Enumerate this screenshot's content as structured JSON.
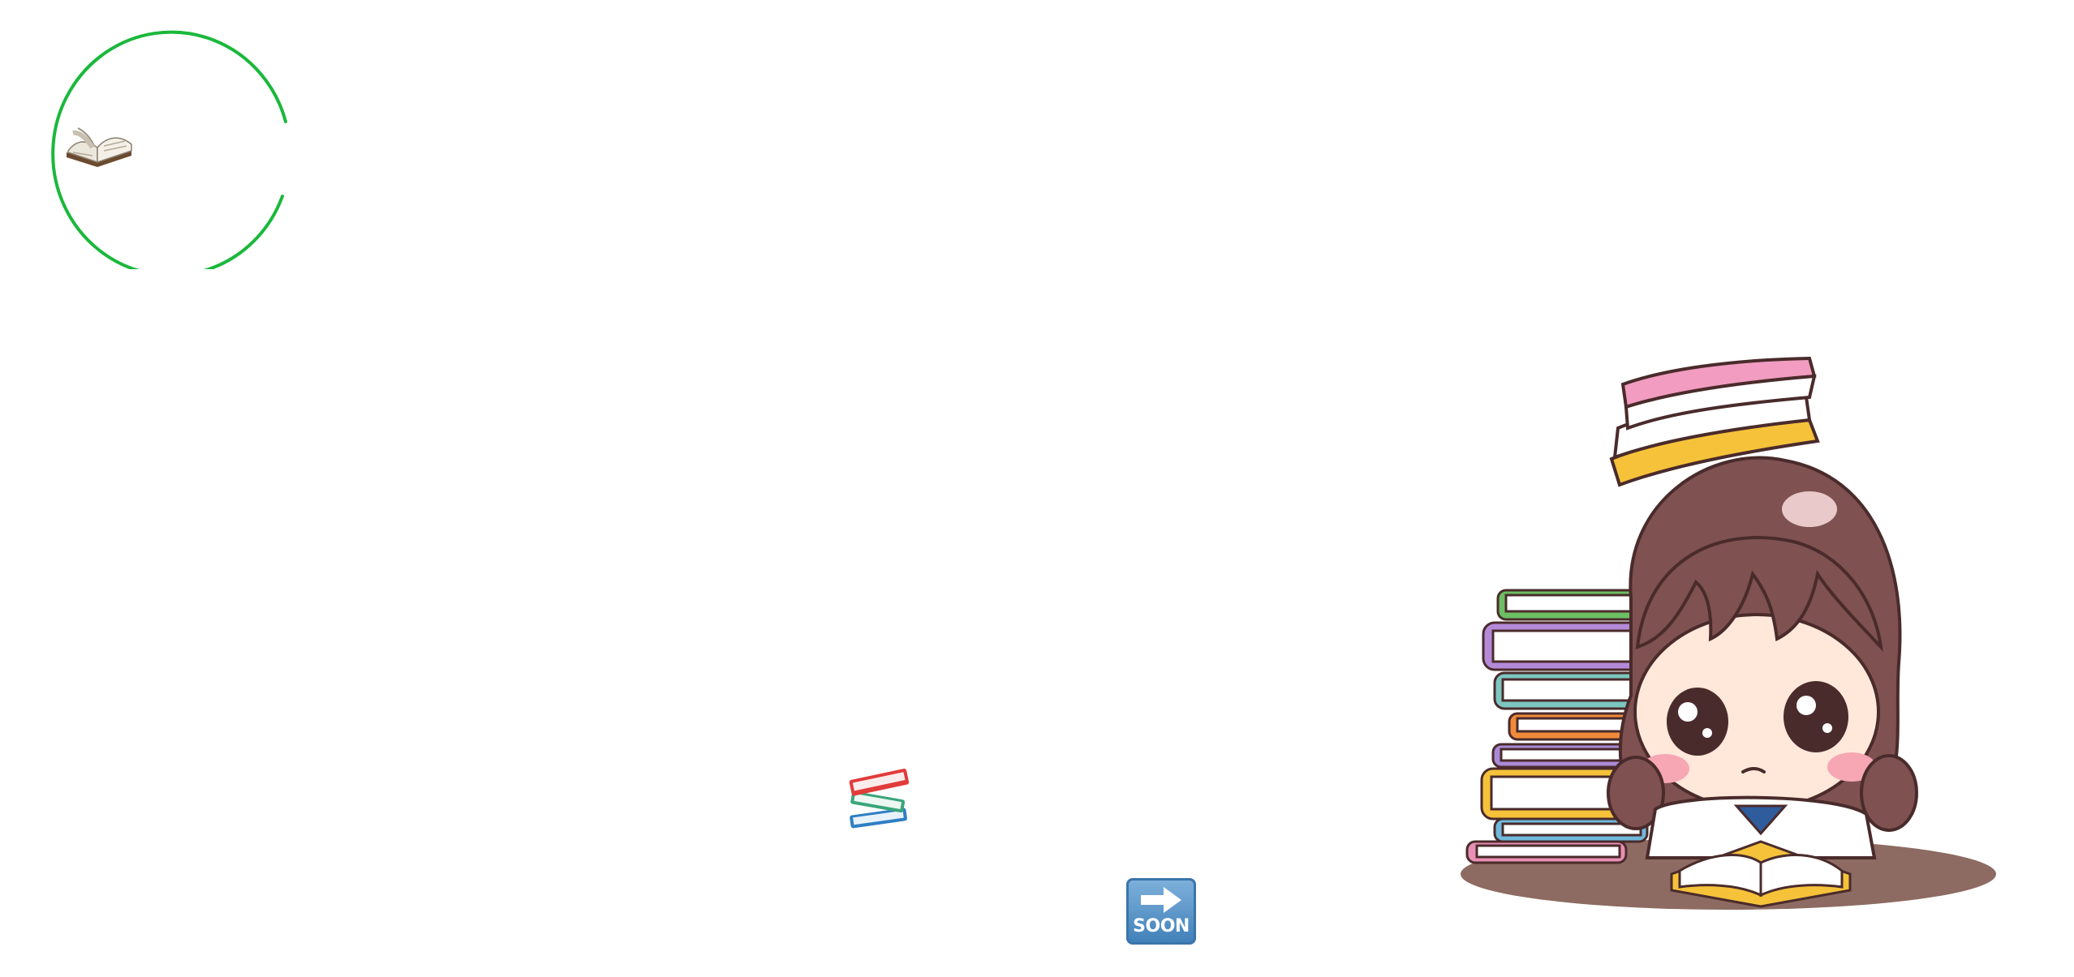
{
  "logo": {
    "icon": "open-book-icon",
    "ring_color": "#1ab83b"
  },
  "stack_icon": {
    "icon": "books-stack-icon"
  },
  "soon_button": {
    "label": "SOON",
    "icon": "soon-arrow-icon",
    "color": "#4a8ac4"
  },
  "illustration": {
    "subject": "girl-studying-with-book-stacks-illustration"
  }
}
